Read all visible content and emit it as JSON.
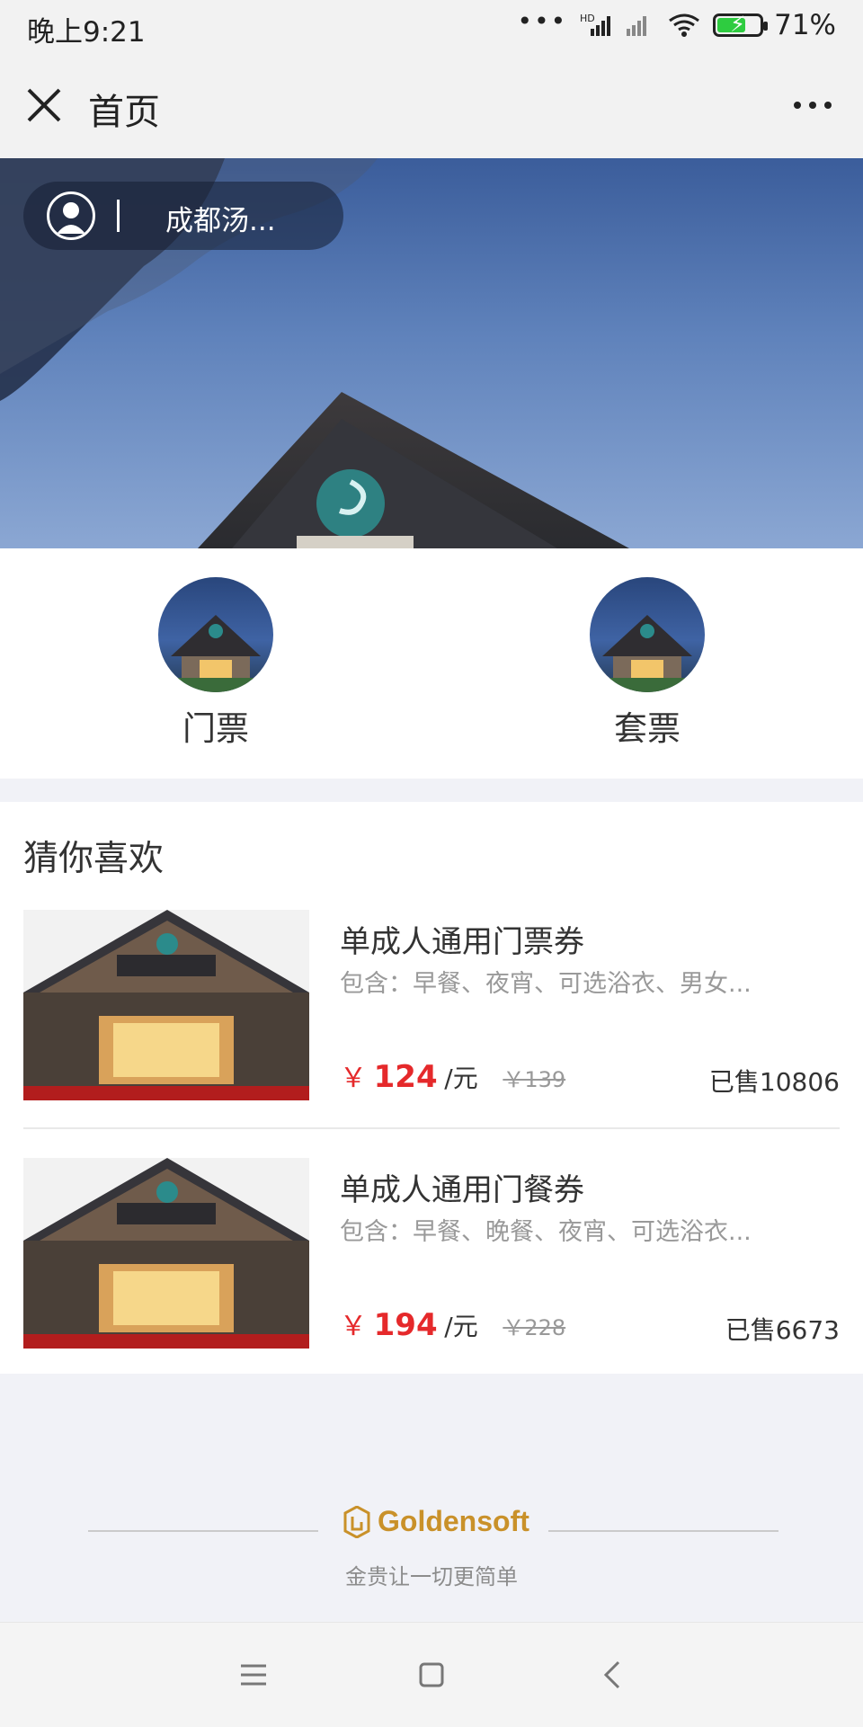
{
  "status_bar": {
    "time": "晚上9:21",
    "battery": "71%",
    "signal_label": "HD"
  },
  "nav": {
    "title": "首页",
    "close_icon": "close-icon",
    "more_icon": "more-icon"
  },
  "hero": {
    "location": "成都汤..."
  },
  "categories": [
    {
      "label": "门票"
    },
    {
      "label": "套票"
    }
  ],
  "recommend": {
    "title": "猜你喜欢",
    "products": [
      {
        "title": "单成人通用门票券",
        "desc": "包含：早餐、夜宵、可选浴衣、男女...",
        "price_symbol": "￥",
        "price": "124",
        "unit": "/元",
        "old_price": "￥139",
        "sold": "已售10806"
      },
      {
        "title": "单成人通用门餐券",
        "desc": "包含：早餐、晚餐、夜宵、可选浴衣...",
        "price_symbol": "￥",
        "price": "194",
        "unit": "/元",
        "old_price": "￥228",
        "sold": "已售6673"
      }
    ]
  },
  "footer": {
    "brand": "Goldensoft",
    "slogan": "金贵让一切更简单"
  },
  "system_nav": [
    "menu-icon",
    "home-icon",
    "back-icon"
  ],
  "colors": {
    "accent_red": "#e5292b",
    "brand_gold": "#c9912a"
  }
}
